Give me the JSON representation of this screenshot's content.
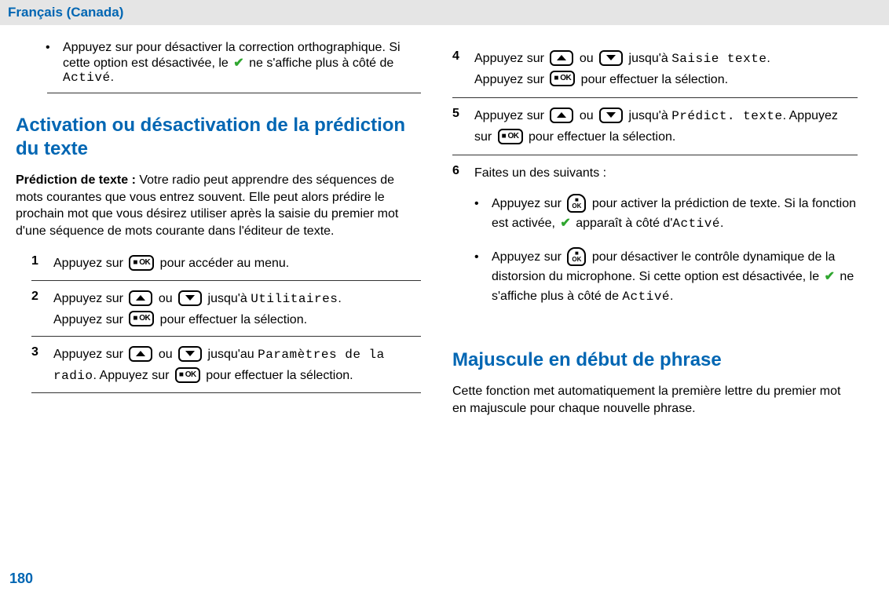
{
  "langHeader": "Français (Canada)",
  "pageNumber": "180",
  "left": {
    "topBullet": {
      "pre": "Appuyez sur pour désactiver la correction orthographique. Si cette option est désactivée, le ",
      "post": " ne s'affiche plus à côté de ",
      "mono": "Activé",
      "end": "."
    },
    "h2": "Activation ou désactivation de la prédiction du texte",
    "lead": {
      "bold": "Prédiction de texte :",
      "rest": " Votre radio peut apprendre des séquences de mots courantes que vous entrez souvent. Elle peut alors prédire le prochain mot que vous désirez utiliser après la saisie du premier mot d'une séquence de mots courante dans l'éditeur de texte."
    },
    "steps": {
      "s1": {
        "pre": "Appuyez sur ",
        "post": " pour accéder au menu."
      },
      "s2": {
        "pre": "Appuyez sur ",
        "mid": " ou ",
        "post": " jusqu'à ",
        "mono": "Utilitaires",
        "end": ".",
        "line2pre": "Appuyez sur ",
        "line2post": " pour effectuer la sélection."
      },
      "s3": {
        "pre": "Appuyez sur ",
        "mid": " ou ",
        "post": " jusqu'au ",
        "mono": "Paramètres de la radio",
        "end": ". Appuyez sur ",
        "tail": " pour effectuer la sélection."
      }
    },
    "nums": {
      "n1": "1",
      "n2": "2",
      "n3": "3"
    }
  },
  "right": {
    "steps": {
      "s4": {
        "pre": "Appuyez sur ",
        "mid": " ou ",
        "post": " jusqu'à ",
        "mono": "Saisie texte",
        "end": ".",
        "line2pre": "Appuyez sur ",
        "line2post": " pour effectuer la sélection."
      },
      "s5": {
        "pre": "Appuyez sur ",
        "mid": " ou ",
        "post": " jusqu'à ",
        "mono": "Prédict. texte",
        "end": ". Appuyez sur ",
        "tail": " pour effectuer la sélection."
      },
      "s6": {
        "intro": "Faites un des suivants :",
        "b1": {
          "pre": "Appuyez sur ",
          "post": " pour activer la prédiction de texte. Si la fonction est activée, ",
          "mid2": " apparaît à côté d'",
          "mono": "Activé",
          "end": "."
        },
        "b2": {
          "pre": "Appuyez sur ",
          "post": " pour désactiver le contrôle dynamique de la distorsion du microphone. Si cette option est désactivée, le ",
          "mid2": " ne s'affiche plus à côté de ",
          "mono": "Activé",
          "end": "."
        }
      }
    },
    "nums": {
      "n4": "4",
      "n5": "5",
      "n6": "6"
    },
    "h2": "Majuscule en début de phrase",
    "lead": "Cette fonction met automatiquement la première lettre du premier mot en majuscule pour chaque nouvelle phrase."
  }
}
